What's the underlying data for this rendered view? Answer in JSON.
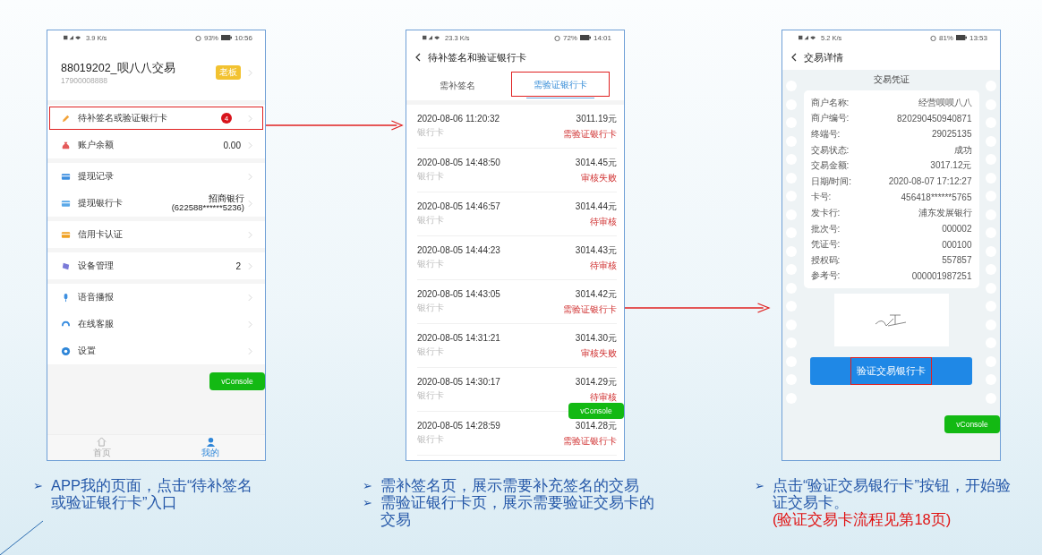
{
  "phones": [
    {
      "kind": "profile",
      "status": {
        "speed": "3.9 K/s",
        "battery": "93%",
        "time": "10:56"
      },
      "account": {
        "name": "88019202_呗八八交易",
        "phone": "17900008888",
        "role": "老板"
      },
      "groups": [
        [
          {
            "label": "待补签名或验证银行卡",
            "badge": "4",
            "highlighted": true
          },
          {
            "label": "账户余额",
            "value": "0.00",
            "highlighted": false
          }
        ],
        [
          {
            "label": "提现记录",
            "highlighted": false
          },
          {
            "label": "提现银行卡",
            "value": "招商银行",
            "value_sub": "(622588******5236)",
            "highlighted": false
          }
        ],
        [
          {
            "label": "信用卡认证",
            "highlighted": false
          }
        ],
        [
          {
            "label": "设备管理",
            "value": "2",
            "highlighted": false
          }
        ],
        [
          {
            "label": "语音播报",
            "highlighted": false
          },
          {
            "label": "在线客服",
            "highlighted": false
          },
          {
            "label": "设置",
            "highlighted": false
          }
        ]
      ],
      "vconsole": "vConsole",
      "tabbar": [
        {
          "label": "首页",
          "selected": false
        },
        {
          "label": "我的",
          "selected": true
        }
      ]
    },
    {
      "kind": "list",
      "status": {
        "speed": "23.3 K/s",
        "battery": "72%",
        "time": "14:01"
      },
      "title": "待补签名和验证银行卡",
      "tabs": [
        {
          "label": "需补签名",
          "selected": false,
          "highlighted": false
        },
        {
          "label": "需验证银行卡",
          "selected": true,
          "highlighted": true
        }
      ],
      "rows": [
        {
          "datetime": "2020-08-06 11:20:32",
          "method": "银行卡",
          "amount": "3011.19元",
          "status": "需验证银行卡"
        },
        {
          "datetime": "2020-08-05 14:48:50",
          "method": "银行卡",
          "amount": "3014.45元",
          "status": "审核失败"
        },
        {
          "datetime": "2020-08-05 14:46:57",
          "method": "银行卡",
          "amount": "3014.44元",
          "status": "待审核"
        },
        {
          "datetime": "2020-08-05 14:44:23",
          "method": "银行卡",
          "amount": "3014.43元",
          "status": "待审核"
        },
        {
          "datetime": "2020-08-05 14:43:05",
          "method": "银行卡",
          "amount": "3014.42元",
          "status": "需验证银行卡"
        },
        {
          "datetime": "2020-08-05 14:31:21",
          "method": "银行卡",
          "amount": "3014.30元",
          "status": "审核失败"
        },
        {
          "datetime": "2020-08-05 14:30:17",
          "method": "银行卡",
          "amount": "3014.29元",
          "status": "待审核"
        },
        {
          "datetime": "2020-08-05 14:28:59",
          "method": "银行卡",
          "amount": "3014.28元",
          "status": "需验证银行卡"
        }
      ],
      "vconsole": "vConsole"
    },
    {
      "kind": "receipt",
      "status": {
        "speed": "5.2 K/s",
        "battery": "81%",
        "time": "13:53"
      },
      "title": "交易详情",
      "receipt_title": "交易凭证",
      "fields": [
        {
          "label": "商户名称:",
          "value": "经营呗呗八八"
        },
        {
          "label": "商户编号:",
          "value": "820290450940871"
        },
        {
          "label": "终端号:",
          "value": "29025135"
        },
        {
          "label": "交易状态:",
          "value": "成功"
        },
        {
          "label": "交易金额:",
          "value": "3017.12元"
        },
        {
          "label": "日期/时间:",
          "value": "2020-08-07 17:12:27"
        },
        {
          "label": "卡号:",
          "value": "456418******5765"
        },
        {
          "label": "发卡行:",
          "value": "浦东发展银行"
        },
        {
          "label": "批次号:",
          "value": "000002"
        },
        {
          "label": "凭证号:",
          "value": "000100"
        },
        {
          "label": "授权码:",
          "value": "557857"
        },
        {
          "label": "参考号:",
          "value": "000001987251"
        }
      ],
      "button": {
        "label": "验证交易银行卡",
        "highlighted": true
      },
      "vconsole": "vConsole"
    }
  ],
  "captions": [
    {
      "bullets": [
        {
          "marker": "➢",
          "text": "APP我的页面，点击“待补签名或验证银行卡”入口"
        }
      ]
    },
    {
      "bullets": [
        {
          "marker": "➢",
          "text": "需补签名页，展示需要补充签名的交易"
        },
        {
          "marker": "➢",
          "text": "需验证银行卡页，展示需要验证交易卡的交易"
        }
      ]
    },
    {
      "bullets": [
        {
          "marker": "➢",
          "text": "点击“验证交易银行卡”按钮，开始验证交易卡。",
          "note": "(验证交易卡流程见第18页)"
        }
      ]
    }
  ]
}
